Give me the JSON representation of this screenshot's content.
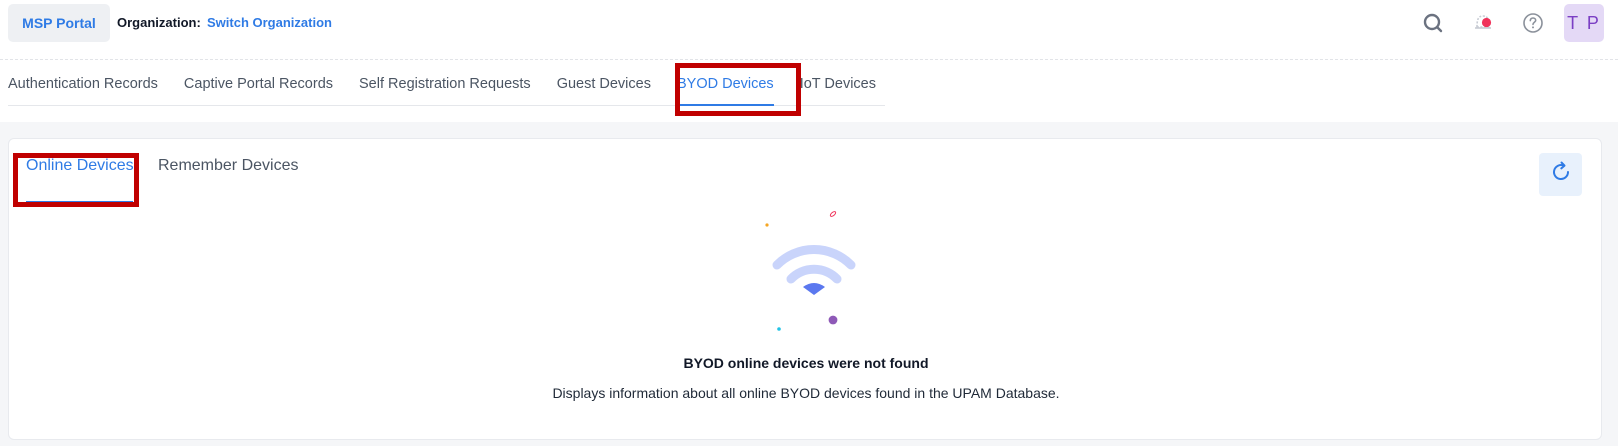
{
  "header": {
    "portal_button": "MSP Portal",
    "org_label": "Organization:",
    "org_switch": "Switch Organization",
    "avatar_initials": "T P",
    "icons": [
      "search-icon",
      "notification-bell-icon",
      "help-icon"
    ]
  },
  "tabs": [
    {
      "label": "Authentication Records",
      "active": false
    },
    {
      "label": "Captive Portal Records",
      "active": false
    },
    {
      "label": "Self Registration Requests",
      "active": false
    },
    {
      "label": "Guest Devices",
      "active": false
    },
    {
      "label": "BYOD Devices",
      "active": true
    },
    {
      "label": "IoT Devices",
      "active": false
    }
  ],
  "subtabs": [
    {
      "label": "Online Devices",
      "active": true
    },
    {
      "label": "Remember Devices",
      "active": false
    }
  ],
  "empty_state": {
    "title": "BYOD online devices were not found",
    "description": "Displays information about all online BYOD devices found in the UPAM Database.",
    "icon": "wifi-icon"
  },
  "colors": {
    "accent": "#2f7be5",
    "highlight": "#c00000",
    "avatar_bg": "#e4d9f6",
    "notification_dot": "#f0325a"
  }
}
